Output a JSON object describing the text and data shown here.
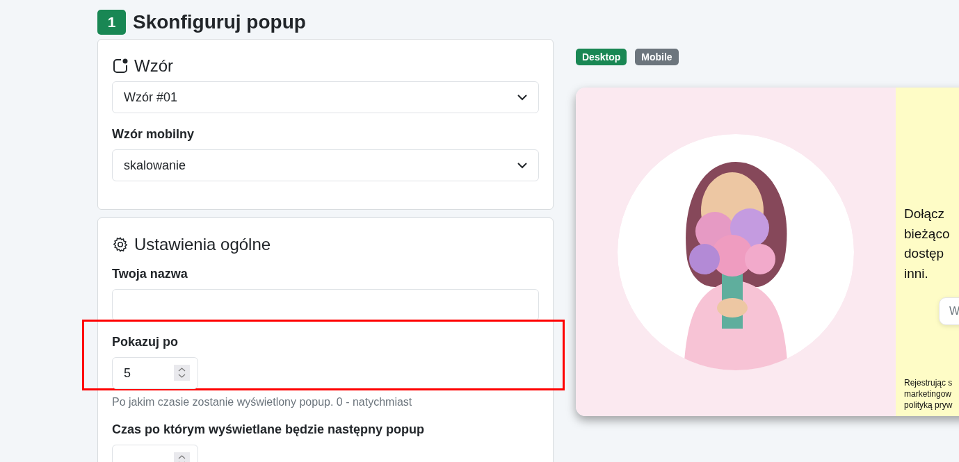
{
  "step": {
    "number": "1",
    "title": "Skonfiguruj popup"
  },
  "template_card": {
    "title": "Wzór",
    "template_select": {
      "value": "Wzór #01"
    },
    "mobile_label": "Wzór mobilny",
    "mobile_select": {
      "value": "skalowanie"
    }
  },
  "general_card": {
    "title": "Ustawienia ogólne",
    "fields": [
      {
        "kind": "text",
        "label": "Twoja nazwa",
        "highlighted": false
      },
      {
        "kind": "number",
        "label": "Pokazuj po",
        "value": "5",
        "help": "Po jakim czasie zostanie wyświetlony popup. 0 - natychmiast",
        "highlighted": true
      },
      {
        "kind": "number",
        "label": "Czas po którym wyświetlane będzie następny popup",
        "highlighted": false
      }
    ]
  },
  "preview_tabs": [
    {
      "label": "Desktop",
      "selected": true
    },
    {
      "label": "Mobile",
      "selected": false
    }
  ],
  "popup_preview": {
    "text_lines": [
      "Dołącz",
      "bieżąco",
      "dostęp",
      "inni."
    ],
    "email_field": {
      "placeholder": "W"
    },
    "consent_lines": [
      "Rejestrując s",
      "marketingow",
      "polityką pryw"
    ]
  }
}
